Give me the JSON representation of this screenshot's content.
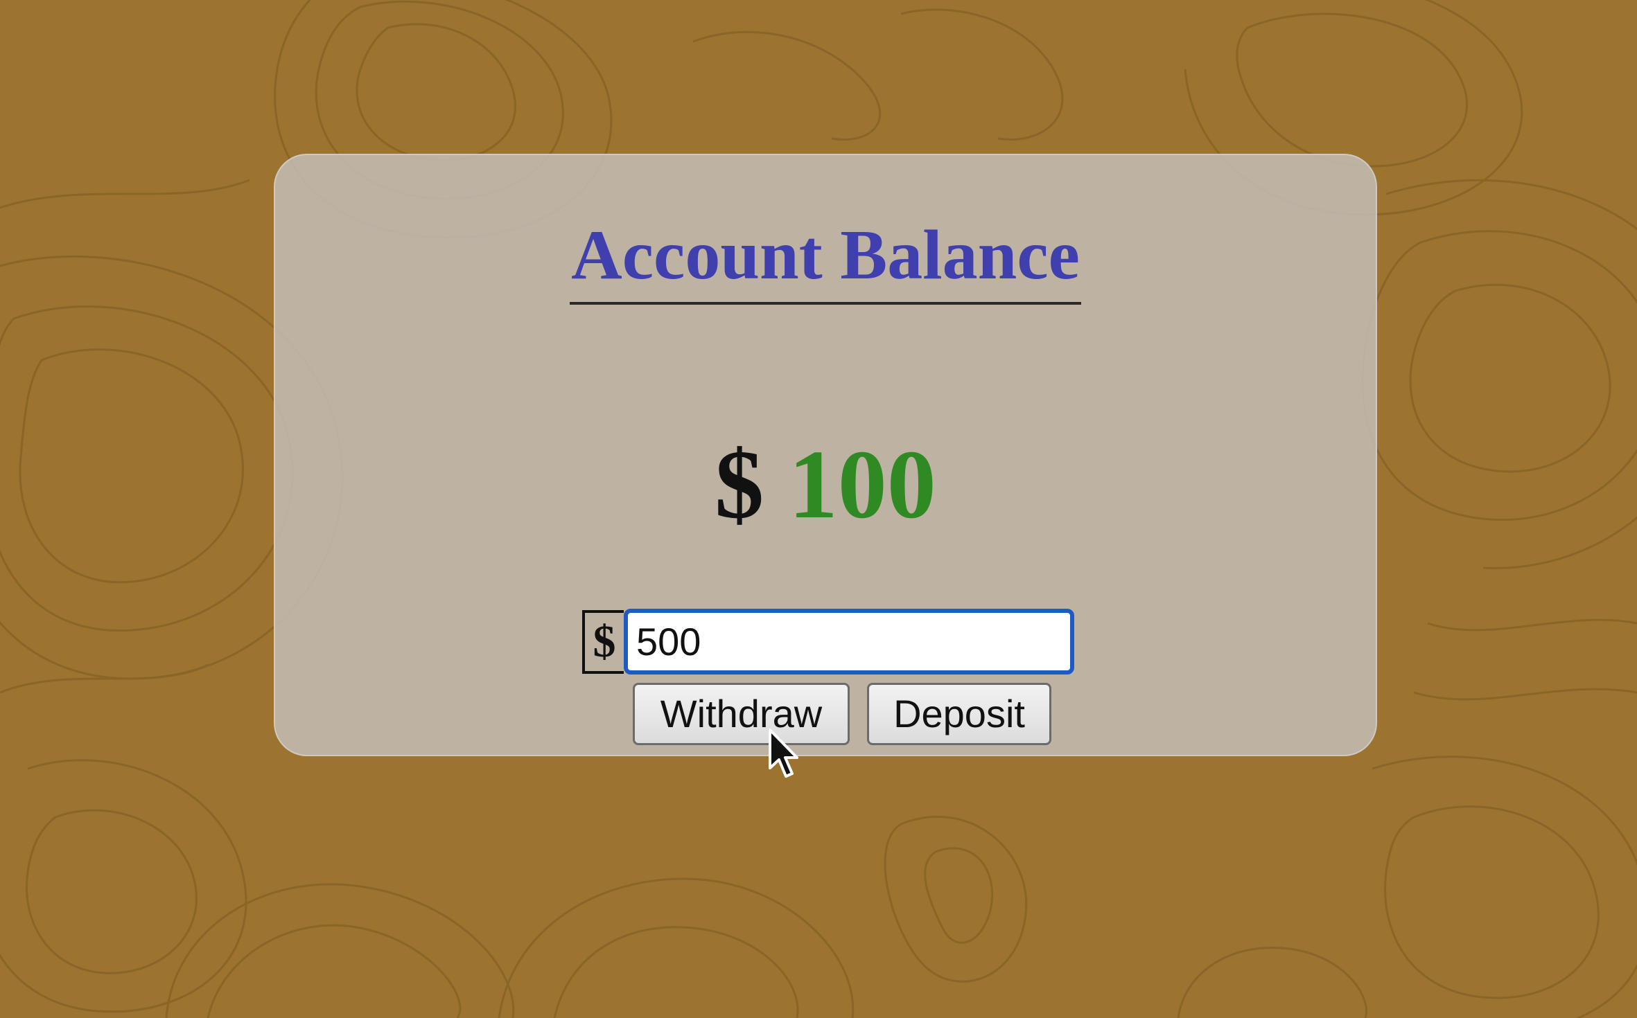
{
  "page": {
    "background_color": "#9c732f",
    "contour_line_color": "#7a5a24"
  },
  "account": {
    "title": "Account Balance",
    "currency_symbol": "$",
    "balance_value": "100",
    "title_color": "#3f3fae",
    "balance_color": "#2f8a23"
  },
  "amount_form": {
    "currency_label": "$",
    "input_value": "500",
    "focus_color": "#1d5bc2",
    "withdraw_label": "Withdraw",
    "deposit_label": "Deposit"
  }
}
